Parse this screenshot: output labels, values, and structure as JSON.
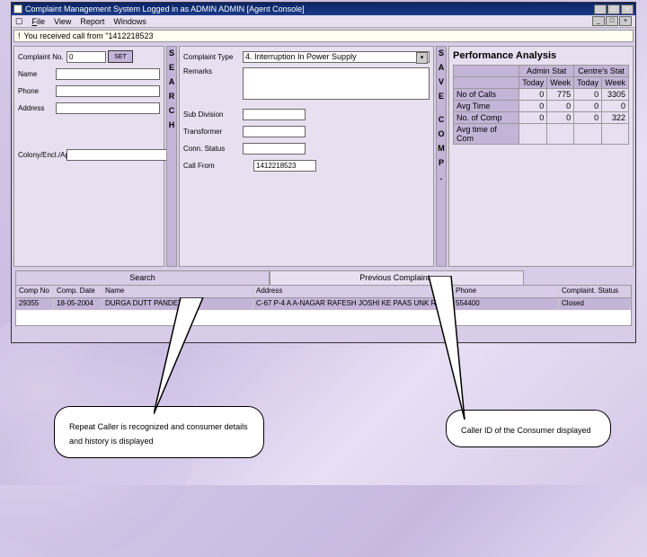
{
  "window": {
    "title": "Complaint Management System Logged in as ADMIN   ADMIN   [Agent Console]",
    "menu": {
      "file": "File",
      "view": "View",
      "report": "Report",
      "windows": "Windows"
    },
    "infobar": "You received call from \"1412218523"
  },
  "left": {
    "complaint_no_label": "Complaint No.",
    "complaint_no_value": "0",
    "set_btn": "SET",
    "name_label": "Name",
    "phone_label": "Phone",
    "address_label": "Address",
    "colony_label": "Colony/Encl./Ap"
  },
  "vstrip1": [
    "S",
    "E",
    "A",
    "R",
    "C",
    "H"
  ],
  "mid": {
    "complaint_type_label": "Complaint Type",
    "complaint_type_value": "4. Interruption In Power Supply",
    "remarks_label": "Remarks",
    "subdiv_label": "Sub Division",
    "transformer_label": "Transformer",
    "connstatus_label": "Conn. Status",
    "callfrom_label": "Call From",
    "callfrom_value": "1412218523"
  },
  "vstrip2": [
    "S",
    "A",
    "V",
    "E",
    "",
    "C",
    "O",
    "M",
    "P",
    "."
  ],
  "perf": {
    "title": "Performance Analysis",
    "cols": {
      "admin": "Admin Stat",
      "centre": "Centre's Stat",
      "today": "Today",
      "week": "Week"
    },
    "rows": {
      "calls": {
        "label": "No of Calls",
        "at": "0",
        "aw": "775",
        "ct": "0",
        "cw": "3305"
      },
      "avgtime": {
        "label": "Avg Time",
        "at": "0",
        "aw": "0",
        "ct": "0",
        "cw": "0"
      },
      "comp": {
        "label": "No. of Comp",
        "at": "0",
        "aw": "0",
        "ct": "0",
        "cw": "322"
      },
      "avgcomp": {
        "label": "Avg time of Com",
        "at": "",
        "aw": "",
        "ct": "",
        "cw": ""
      }
    }
  },
  "tabs": {
    "search": "Search",
    "prev": "Previous Complaints"
  },
  "grid": {
    "headers": {
      "c1": "Comp No",
      "c2": "Comp. Date",
      "c3": "Name",
      "c4": "Address",
      "c5": "Phone",
      "c6": "Complaint. Status"
    },
    "row": {
      "c1": "29355",
      "c2": "18-05-2004",
      "c3": "DURGA DUTT   PANDEY",
      "c4": "C-67 P-4 A  A-NAGAR RAFESH JOSHI KE PAAS   UNK RD",
      "c5": "554400",
      "c6": "Closed"
    }
  },
  "callouts": {
    "left": "Repeat Caller is recognized and consumer details and history is displayed",
    "right": "Caller ID of the Consumer displayed"
  }
}
